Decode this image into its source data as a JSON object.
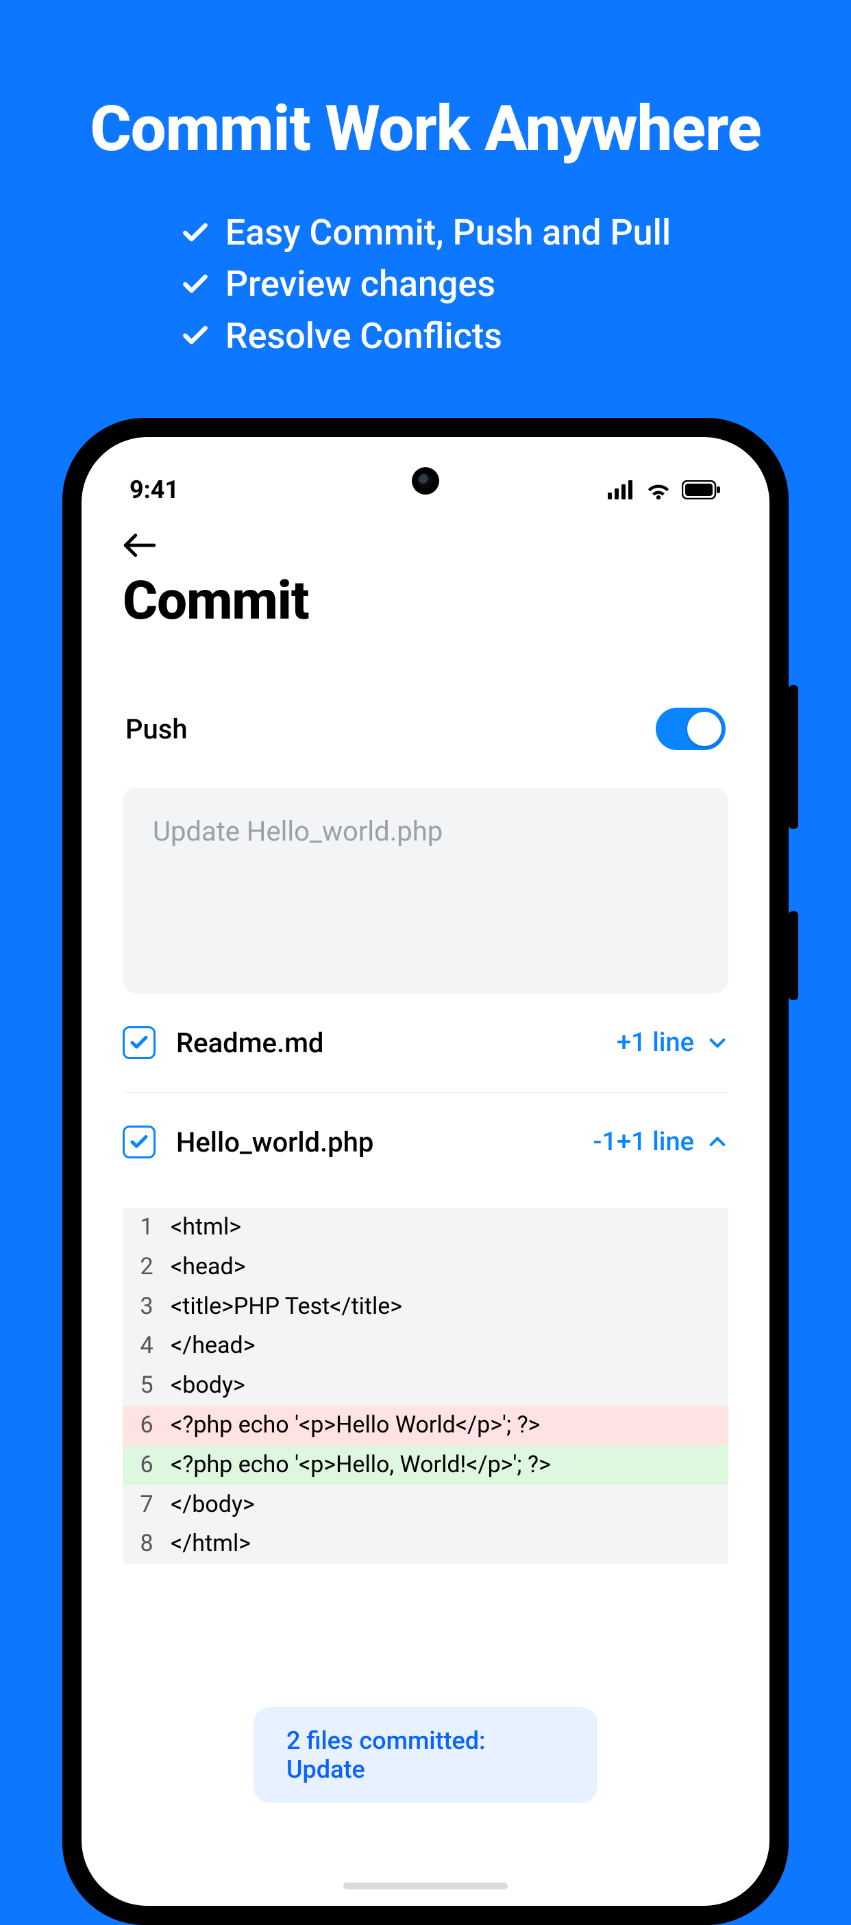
{
  "hero": {
    "title": "Commit Work Anywhere",
    "items": [
      "Easy Commit, Push and Pull",
      "Preview changes",
      "Resolve Conflicts"
    ]
  },
  "status": {
    "time": "9:41"
  },
  "screen": {
    "title": "Commit",
    "push_label": "Push",
    "push_on": true,
    "commit_message_placeholder": "Update Hello_world.php",
    "files": [
      {
        "name": "Readme.md",
        "summary": "+1 line",
        "expanded": false
      },
      {
        "name": "Hello_world.php",
        "summary": "-1+1 line",
        "expanded": true
      }
    ],
    "diff": [
      {
        "n": "1",
        "t": "<html>",
        "k": "ctx"
      },
      {
        "n": "2",
        "t": "<head>",
        "k": "ctx"
      },
      {
        "n": "3",
        "t": "<title>PHP Test</title>",
        "k": "ctx"
      },
      {
        "n": "4",
        "t": "</head>",
        "k": "ctx"
      },
      {
        "n": "5",
        "t": "<body>",
        "k": "ctx"
      },
      {
        "n": "6",
        "t": "<?php echo '<p>Hello World</p>'; ?>",
        "k": "removed"
      },
      {
        "n": "6",
        "t": "<?php echo '<p>Hello, World!</p>'; ?>",
        "k": "added"
      },
      {
        "n": "7",
        "t": "</body>",
        "k": "ctx"
      },
      {
        "n": "8",
        "t": "</html>",
        "k": "ctx"
      }
    ],
    "toast": "2 files committed: Update"
  },
  "colors": {
    "accent": "#0a84ff",
    "bg": "#0d78ff"
  }
}
